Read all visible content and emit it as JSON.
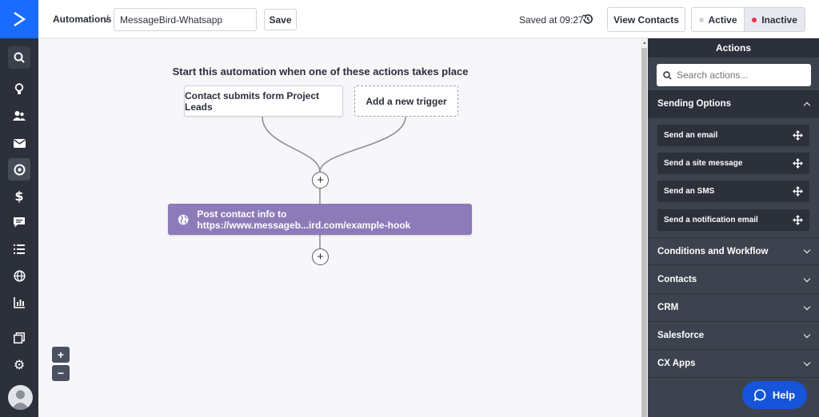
{
  "header": {
    "breadcrumb": "Automations",
    "separator": "/",
    "automation_name": "MessageBird-Whatsapp",
    "save_label": "Save",
    "saved_status": "Saved at 09:27",
    "view_contacts_label": "View Contacts",
    "status_active_label": "Active",
    "status_inactive_label": "Inactive",
    "status_selected": "Inactive"
  },
  "nav": {
    "icons": [
      "search-icon",
      "lightbulb-icon",
      "contacts-icon",
      "email-icon",
      "automations-icon",
      "deals-icon",
      "conversations-icon",
      "lists-icon",
      "website-icon",
      "reports-icon",
      "apps-icon",
      "settings-icon",
      "user-avatar"
    ]
  },
  "canvas": {
    "title": "Start this automation when one of these actions takes place",
    "trigger_1": "Contact submits form Project Leads",
    "trigger_add": "Add a new trigger",
    "action_1": "Post contact info to https://www.messageb...ird.com/example-hook",
    "plus_symbol": "+",
    "zoom_in": "+",
    "zoom_out": "−"
  },
  "panel": {
    "title": "Actions",
    "search_placeholder": "Search actions...",
    "sections": {
      "sending_options": "Sending Options",
      "conditions": "Conditions and Workflow",
      "contacts": "Contacts",
      "crm": "CRM",
      "salesforce": "Salesforce",
      "cx_apps": "CX Apps"
    },
    "sending_items": {
      "email": "Send an email",
      "site_message": "Send a site message",
      "sms": "Send an SMS",
      "notification": "Send a notification email"
    }
  },
  "help_label": "Help",
  "colors": {
    "brand_blue": "#1a6cff",
    "nav_bg": "#2b303b",
    "action_purple": "#8c7bb8",
    "inactive_dot": "#e8334a",
    "active_dot": "#d0d3da",
    "help_button": "#1655d9"
  }
}
